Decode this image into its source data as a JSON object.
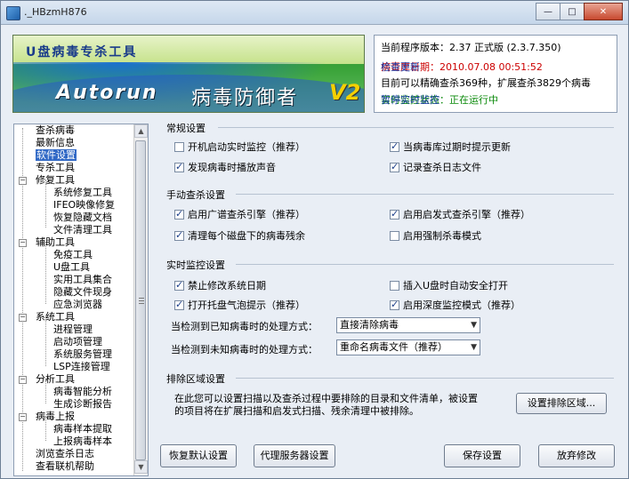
{
  "window": {
    "title": "._HBzmH876"
  },
  "banner": {
    "top_text": "U盘病毒专杀工具",
    "brand_en": "Autorun",
    "brand_zh": "病毒防御者",
    "brand_ver": "V2"
  },
  "info": {
    "version": "当前程序版本：2.37 正式版 (2.3.7.350)",
    "db_date": "病毒库日期：2010.07.08 00:51:52",
    "check_update": "检查更新",
    "capability": "目前可以精确查杀369种，扩展查杀3829个病毒",
    "monitor_status": "实时监控状态：正在运行中",
    "pause_monitor": "暂停实时监控"
  },
  "nav": {
    "items": [
      {
        "label": "查杀病毒"
      },
      {
        "label": "最新信息"
      },
      {
        "label": "软件设置"
      },
      {
        "label": "专杀工具"
      },
      {
        "label": "修复工具"
      },
      {
        "label": "系统修复工具"
      },
      {
        "label": "IFEO映像修复"
      },
      {
        "label": "恢复隐藏文档"
      },
      {
        "label": "文件清理工具"
      },
      {
        "label": "辅助工具"
      },
      {
        "label": "免疫工具"
      },
      {
        "label": "U盘工具"
      },
      {
        "label": "实用工具集合"
      },
      {
        "label": "隐藏文件现身"
      },
      {
        "label": "应急浏览器"
      },
      {
        "label": "系统工具"
      },
      {
        "label": "进程管理"
      },
      {
        "label": "启动项管理"
      },
      {
        "label": "系统服务管理"
      },
      {
        "label": "LSP连接管理"
      },
      {
        "label": "分析工具"
      },
      {
        "label": "病毒智能分析"
      },
      {
        "label": "生成诊断报告"
      },
      {
        "label": "病毒上报"
      },
      {
        "label": "病毒样本提取"
      },
      {
        "label": "上报病毒样本"
      },
      {
        "label": "浏览查杀日志"
      },
      {
        "label": "查看联机帮助"
      }
    ]
  },
  "general": {
    "title": "常规设置",
    "opt1": "开机启动实时监控（推荐）",
    "opt2": "当病毒库过期时提示更新",
    "opt3": "发现病毒时播放声音",
    "opt4": "记录查杀日志文件"
  },
  "manual": {
    "title": "手动查杀设置",
    "opt1": "启用广谱查杀引擎（推荐）",
    "opt2": "启用启发式查杀引擎（推荐）",
    "opt3": "清理每个磁盘下的病毒残余",
    "opt4": "启用强制杀毒模式"
  },
  "realtime": {
    "title": "实时监控设置",
    "opt1": "禁止修改系统日期",
    "opt2": "插入U盘时自动安全打开",
    "opt3": "打开托盘气泡提示（推荐）",
    "opt4": "启用深度监控模式（推荐）",
    "known_label": "当检测到已知病毒时的处理方式：",
    "known_value": "直接清除病毒",
    "unknown_label": "当检测到未知病毒时的处理方式：",
    "unknown_value": "重命名病毒文件（推荐）"
  },
  "exclude": {
    "title": "排除区域设置",
    "note1": "在此您可以设置扫描以及查杀过程中要排除的目录和文件清单，被设置",
    "note2": "的项目将在扩展扫描和启发式扫描、残余清理中被排除。",
    "button": "设置排除区域..."
  },
  "footer": {
    "restore": "恢复默认设置",
    "proxy": "代理服务器设置",
    "save": "保存设置",
    "discard": "放弃修改"
  },
  "colors": {
    "accent": "#1a3ca8",
    "warn": "#cc0000",
    "ok": "#0a8a0a",
    "selection": "#3169c6"
  }
}
